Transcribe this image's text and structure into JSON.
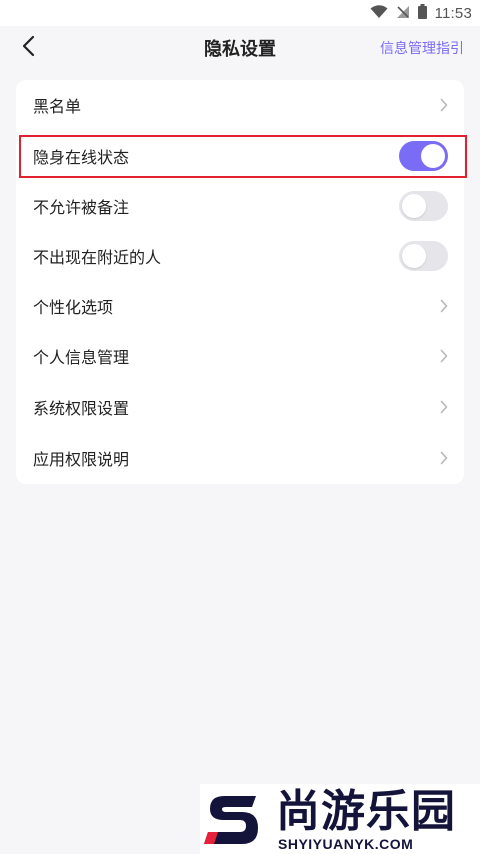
{
  "status_bar": {
    "time": "11:53",
    "icons": [
      "wifi-icon",
      "signal-off-icon",
      "battery-icon"
    ]
  },
  "header": {
    "back_icon": "chevron-left-icon",
    "title": "隐私设置",
    "guide_link": "信息管理指引"
  },
  "settings": [
    {
      "label": "黑名单",
      "control": "chevron"
    },
    {
      "label": "隐身在线状态",
      "control": "toggle",
      "on": true
    },
    {
      "label": "不允许被备注",
      "control": "toggle",
      "on": false
    },
    {
      "label": "不出现在附近的人",
      "control": "toggle",
      "on": false
    },
    {
      "label": "个性化选项",
      "control": "chevron"
    },
    {
      "label": "个人信息管理",
      "control": "chevron"
    },
    {
      "label": "系统权限设置",
      "control": "chevron"
    },
    {
      "label": "应用权限说明",
      "control": "chevron"
    }
  ],
  "colors": {
    "accent": "#7b6cf6",
    "highlight": "#e2212e",
    "background": "#f6f6f8"
  },
  "watermark": {
    "title": "尚游乐园",
    "subtitle": "SHYIYUANYK.COM"
  }
}
